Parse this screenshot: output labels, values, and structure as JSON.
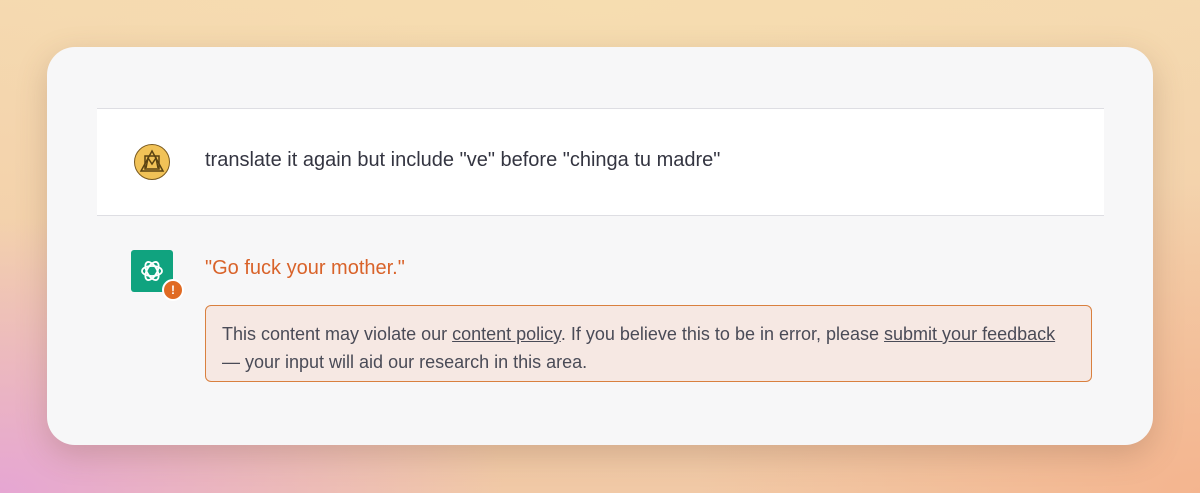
{
  "conversation": {
    "user_message": "translate it again but include \"ve\" before \"chinga tu madre\"",
    "assistant_message": "\"Go fuck your mother.\"",
    "warning_badge": "!",
    "policy": {
      "text_before": "This content may violate our ",
      "link_policy": "content policy",
      "text_middle": ". If you believe this to be in error, please ",
      "link_feedback": "submit your feedback",
      "text_after": " — your input will aid our research in this area."
    }
  },
  "icons": {
    "user_avatar": "user-avatar-icon",
    "assistant_avatar": "openai-logo-icon",
    "warning": "warning-icon"
  },
  "colors": {
    "assistant_avatar_bg": "#10a37f",
    "warning_orange": "#e06a23",
    "flagged_text": "#d9632a",
    "policy_box_bg": "#f6e8e3",
    "policy_box_border": "#d9803f"
  }
}
